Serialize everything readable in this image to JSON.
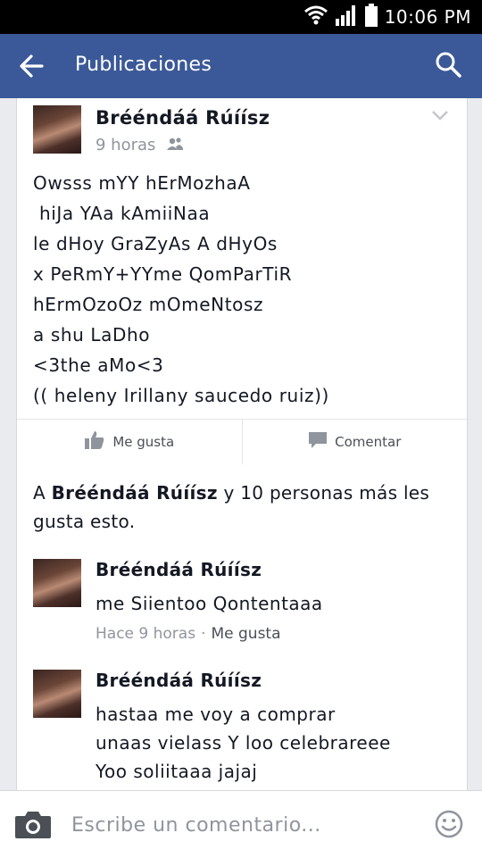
{
  "status_bar": {
    "time": "10:06 PM"
  },
  "app_bar": {
    "title": "Publicaciones"
  },
  "post": {
    "author": "Brééndáá Rúíísz",
    "time": "9 horas",
    "lines": [
      "Owsss mYY hErMozhaA",
      " hiJa YAa kAmiiNaa",
      "le dHoy GraZyAs A dHyOs",
      "x PeRmY+YYme QomParTiR",
      "hErmOzoOz mOmeNtosz",
      "a shu LaDho",
      "<3the aMo<3",
      "(( heleny Irillany saucedo ruiz))"
    ],
    "actions": {
      "like": "Me gusta",
      "comment": "Comentar"
    }
  },
  "likes": {
    "prefix": "A ",
    "name": "Brééndáá Rúíísz",
    "suffix": " y 10 personas más les gusta esto."
  },
  "comments": [
    {
      "author": "Brééndáá Rúíísz",
      "lines": [
        "me Siientoo Qontentaaa"
      ],
      "time": "Hace 9 horas",
      "separator": "·",
      "like": "Me gusta"
    },
    {
      "author": "Brééndáá Rúíísz",
      "lines": [
        "hastaa me voy a comprar",
        "unaas vielass Y loo celebrareee",
        "Yoo soliitaaa jajaj"
      ]
    }
  ],
  "composer": {
    "placeholder": "Escribe un comentario..."
  },
  "colors": {
    "brand": "#3b5998",
    "background": "#e9ebee",
    "muted": "#90949c"
  },
  "icons": [
    "wifi-icon",
    "signal-icon",
    "battery-icon",
    "back-arrow-icon",
    "search-icon",
    "chevron-down-icon",
    "friends-icon",
    "like-icon",
    "comment-icon",
    "camera-icon",
    "emoji-icon"
  ]
}
